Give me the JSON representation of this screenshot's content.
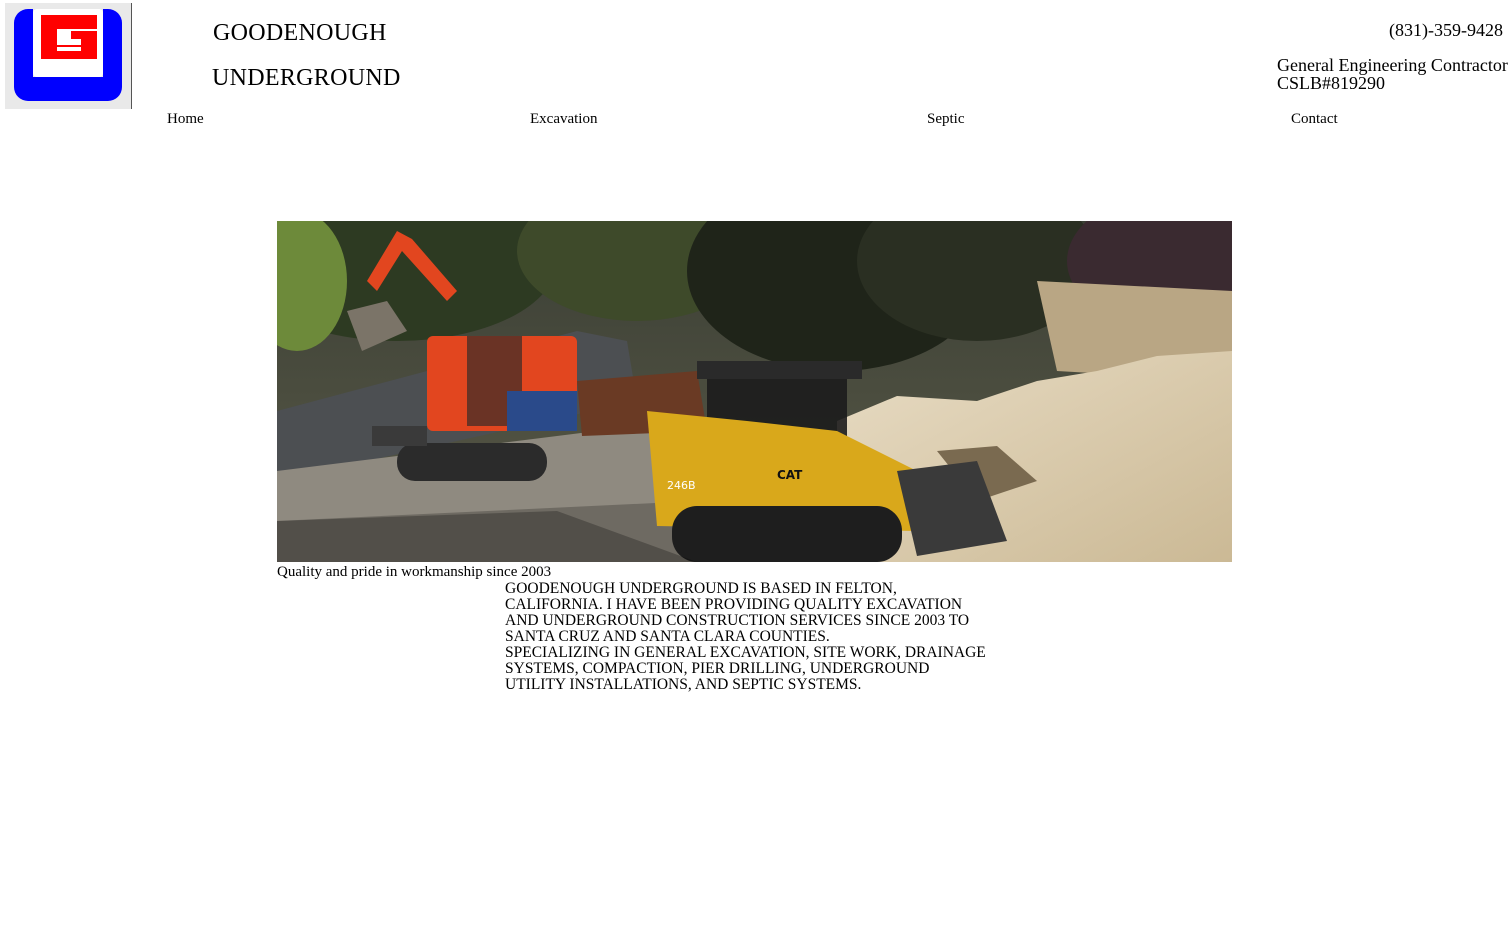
{
  "brand": {
    "line1": "GOODENOUGH",
    "line2": "UNDERGROUND",
    "logo_icon": "gu-monogram-logo",
    "colors": {
      "logo_blue": "#0000ff",
      "logo_red": "#ff0000"
    }
  },
  "header": {
    "phone": "(831)-359-9428",
    "license_line1": "General Engineering Contractor",
    "license_line2": "CSLB#819290"
  },
  "nav": {
    "items": [
      {
        "label": "Home"
      },
      {
        "label": "Excavation"
      },
      {
        "label": "Septic"
      },
      {
        "label": "Contact"
      }
    ]
  },
  "hero": {
    "image_subject": "excavator-and-skid-steer-photo",
    "caption": "Quality and pride in workmanship since 2003"
  },
  "about": {
    "text": "GOODENOUGH UNDERGROUND IS BASED IN FELTON,\nCALIFORNIA. I HAVE BEEN PROVIDING QUALITY EXCAVATION\nAND UNDERGROUND CONSTRUCTION SERVICES SINCE 2003 TO\nSANTA CRUZ AND SANTA CLARA COUNTIES.\nSPECIALIZING IN GENERAL EXCAVATION, SITE WORK, DRAINAGE\nSYSTEMS, COMPACTION, PIER DRILLING, UNDERGROUND\nUTILITY INSTALLATIONS, AND SEPTIC SYSTEMS."
  }
}
